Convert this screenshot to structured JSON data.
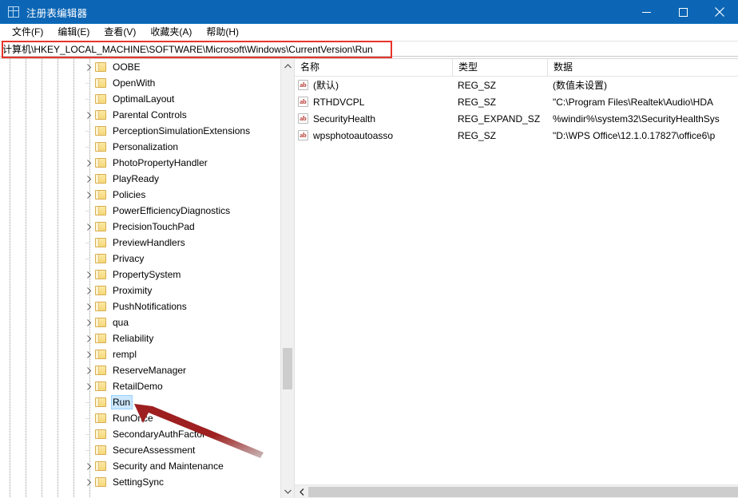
{
  "window": {
    "title": "注册表编辑器",
    "icon": "registry-editor-icon",
    "minimize_label": "最小化",
    "maximize_label": "最大化",
    "close_label": "关闭",
    "titlebar_color": "#0c66b5"
  },
  "menu": {
    "items": [
      {
        "label": "文件(F)",
        "text": "文件",
        "accel": "F"
      },
      {
        "label": "编辑(E)",
        "text": "编辑",
        "accel": "E"
      },
      {
        "label": "查看(V)",
        "text": "查看",
        "accel": "V"
      },
      {
        "label": "收藏夹(A)",
        "text": "收藏夹",
        "accel": "A"
      },
      {
        "label": "帮助(H)",
        "text": "帮助",
        "accel": "H"
      }
    ]
  },
  "address": {
    "path": "计算机\\HKEY_LOCAL_MACHINE\\SOFTWARE\\Microsoft\\Windows\\CurrentVersion\\Run",
    "annotation_color": "#e8342a"
  },
  "tree": {
    "selected": "Run",
    "selection_color": "#cce8ff",
    "items": [
      {
        "label": "OOBE",
        "expandable": true,
        "indent": 6
      },
      {
        "label": "OpenWith",
        "expandable": false,
        "indent": 6
      },
      {
        "label": "OptimalLayout",
        "expandable": false,
        "indent": 6
      },
      {
        "label": "Parental Controls",
        "expandable": true,
        "indent": 6
      },
      {
        "label": "PerceptionSimulationExtensions",
        "expandable": false,
        "indent": 6
      },
      {
        "label": "Personalization",
        "expandable": false,
        "indent": 6
      },
      {
        "label": "PhotoPropertyHandler",
        "expandable": true,
        "indent": 6
      },
      {
        "label": "PlayReady",
        "expandable": true,
        "indent": 6
      },
      {
        "label": "Policies",
        "expandable": true,
        "indent": 6
      },
      {
        "label": "PowerEfficiencyDiagnostics",
        "expandable": false,
        "indent": 6
      },
      {
        "label": "PrecisionTouchPad",
        "expandable": true,
        "indent": 6
      },
      {
        "label": "PreviewHandlers",
        "expandable": false,
        "indent": 6
      },
      {
        "label": "Privacy",
        "expandable": false,
        "indent": 6
      },
      {
        "label": "PropertySystem",
        "expandable": true,
        "indent": 6
      },
      {
        "label": "Proximity",
        "expandable": true,
        "indent": 6
      },
      {
        "label": "PushNotifications",
        "expandable": true,
        "indent": 6
      },
      {
        "label": "qua",
        "expandable": true,
        "indent": 6
      },
      {
        "label": "Reliability",
        "expandable": true,
        "indent": 6
      },
      {
        "label": "rempl",
        "expandable": true,
        "indent": 6
      },
      {
        "label": "ReserveManager",
        "expandable": true,
        "indent": 6
      },
      {
        "label": "RetailDemo",
        "expandable": true,
        "indent": 6
      },
      {
        "label": "Run",
        "expandable": false,
        "indent": 6,
        "selected": true
      },
      {
        "label": "RunOnce",
        "expandable": false,
        "indent": 6
      },
      {
        "label": "SecondaryAuthFactor",
        "expandable": false,
        "indent": 6
      },
      {
        "label": "SecureAssessment",
        "expandable": false,
        "indent": 6
      },
      {
        "label": "Security and Maintenance",
        "expandable": true,
        "indent": 6
      },
      {
        "label": "SettingSync",
        "expandable": true,
        "indent": 6
      }
    ]
  },
  "values": {
    "columns": [
      "名称",
      "类型",
      "数据"
    ],
    "rows": [
      {
        "name": "(默认)",
        "type": "REG_SZ",
        "data": "(数值未设置)",
        "icon": "string-value-icon"
      },
      {
        "name": "RTHDVCPL",
        "type": "REG_SZ",
        "data": "\"C:\\Program Files\\Realtek\\Audio\\HDA",
        "icon": "string-value-icon"
      },
      {
        "name": "SecurityHealth",
        "type": "REG_EXPAND_SZ",
        "data": "%windir%\\system32\\SecurityHealthSys",
        "icon": "string-value-icon"
      },
      {
        "name": "wpsphotoautoasso",
        "type": "REG_SZ",
        "data": "\"D:\\WPS Office\\12.1.0.17827\\office6\\p",
        "icon": "string-value-icon"
      }
    ]
  },
  "annotations": {
    "arrow_color": "#a32020",
    "arrow_target": "Run",
    "rectangle_target": "address-bar"
  }
}
